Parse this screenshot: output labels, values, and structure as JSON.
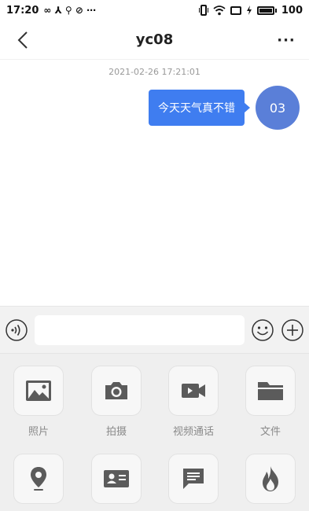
{
  "status_bar": {
    "time": "17:20",
    "left_glyphs": "∞ ⅄ ⚲ ⊘ ⋯",
    "battery": "100"
  },
  "header": {
    "title": "yc08",
    "more_label": "···"
  },
  "chat": {
    "timestamp": "2021-02-26 17:21:01",
    "messages": [
      {
        "text": "今天天气真不错",
        "avatar": "03"
      }
    ]
  },
  "input": {
    "value": "",
    "placeholder": ""
  },
  "panel": {
    "items": [
      {
        "label": "照片",
        "icon": "image-icon"
      },
      {
        "label": "拍摄",
        "icon": "camera-icon"
      },
      {
        "label": "视频通话",
        "icon": "video-call-icon"
      },
      {
        "label": "文件",
        "icon": "folder-icon"
      },
      {
        "label": "",
        "icon": "location-icon"
      },
      {
        "label": "",
        "icon": "contact-card-icon"
      },
      {
        "label": "",
        "icon": "message-icon"
      },
      {
        "label": "",
        "icon": "fire-icon"
      }
    ]
  },
  "colors": {
    "bubble": "#3f7df0",
    "avatar": "#5a7fd8",
    "icon": "#5b5b5b",
    "label": "#8a8a8a"
  }
}
